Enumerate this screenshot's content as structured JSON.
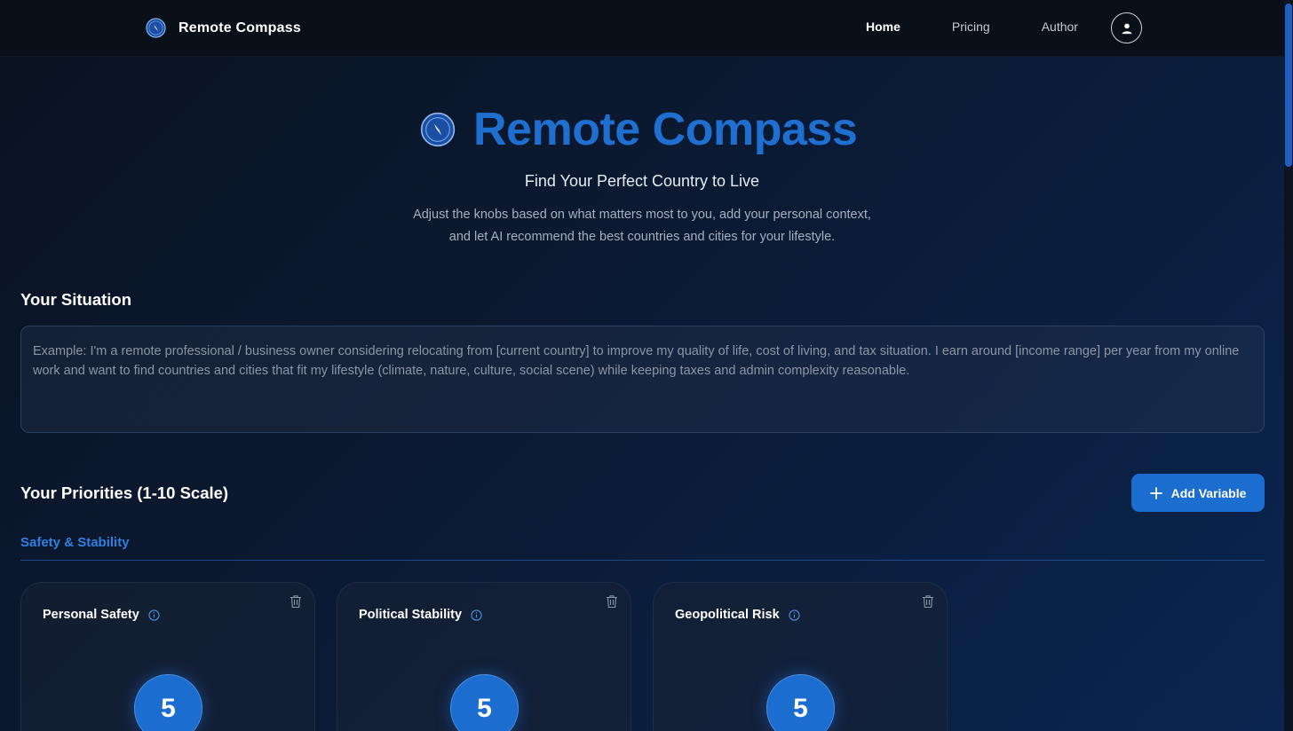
{
  "nav": {
    "brand": "Remote Compass",
    "links": [
      {
        "label": "Home",
        "active": true
      },
      {
        "label": "Pricing",
        "active": false
      },
      {
        "label": "Author",
        "active": false
      }
    ],
    "avatar_icon": "user-icon"
  },
  "hero": {
    "title": "Remote Compass",
    "subtitle": "Find Your Perfect Country to Live",
    "desc_line1": "Adjust the knobs based on what matters most to you, add your personal context,",
    "desc_line2": "and let AI recommend the best countries and cities for your lifestyle."
  },
  "situation": {
    "heading": "Your Situation",
    "placeholder": "Example: I'm a remote professional / business owner considering relocating from [current country] to improve my quality of life, cost of living, and tax situation. I earn around [income range] per year from my online work and want to find countries and cities that fit my lifestyle (climate, nature, culture, social scene) while keeping taxes and admin complexity reasonable.",
    "value": ""
  },
  "priorities": {
    "heading": "Your Priorities (1-10 Scale)",
    "add_button": "Add Variable",
    "category": "Safety & Stability",
    "cards": [
      {
        "name": "Personal Safety",
        "value": "5"
      },
      {
        "name": "Political Stability",
        "value": "5"
      },
      {
        "name": "Geopolitical Risk",
        "value": "5"
      }
    ]
  },
  "colors": {
    "accent": "#1c6dd0",
    "title_blue": "#1f6fd1",
    "category_blue": "#2f80e0",
    "nav_bg": "#0a1019"
  }
}
